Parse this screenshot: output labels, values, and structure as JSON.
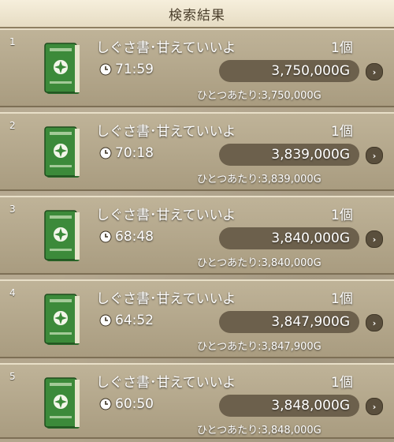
{
  "header": {
    "title": "検索結果"
  },
  "colors": {
    "book_green": "#3c8a3a",
    "price_pill": "#6c604c",
    "panel": "#b3a68d"
  },
  "icons": {
    "time": "clock-icon",
    "detail": "chevron-right-icon",
    "item": "green-book-icon"
  },
  "results": [
    {
      "rank": "1",
      "name": "しぐさ書･甘えていいよ",
      "qty": "1個",
      "time": "71:59",
      "price": "3,750,000G",
      "unit_label": "ひとつあたり:",
      "unit_price": "3,750,000G"
    },
    {
      "rank": "2",
      "name": "しぐさ書･甘えていいよ",
      "qty": "1個",
      "time": "70:18",
      "price": "3,839,000G",
      "unit_label": "ひとつあたり:",
      "unit_price": "3,839,000G"
    },
    {
      "rank": "3",
      "name": "しぐさ書･甘えていいよ",
      "qty": "1個",
      "time": "68:48",
      "price": "3,840,000G",
      "unit_label": "ひとつあたり:",
      "unit_price": "3,840,000G"
    },
    {
      "rank": "4",
      "name": "しぐさ書･甘えていいよ",
      "qty": "1個",
      "time": "64:52",
      "price": "3,847,900G",
      "unit_label": "ひとつあたり:",
      "unit_price": "3,847,900G"
    },
    {
      "rank": "5",
      "name": "しぐさ書･甘えていいよ",
      "qty": "1個",
      "time": "60:50",
      "price": "3,848,000G",
      "unit_label": "ひとつあたり:",
      "unit_price": "3,848,000G"
    }
  ]
}
